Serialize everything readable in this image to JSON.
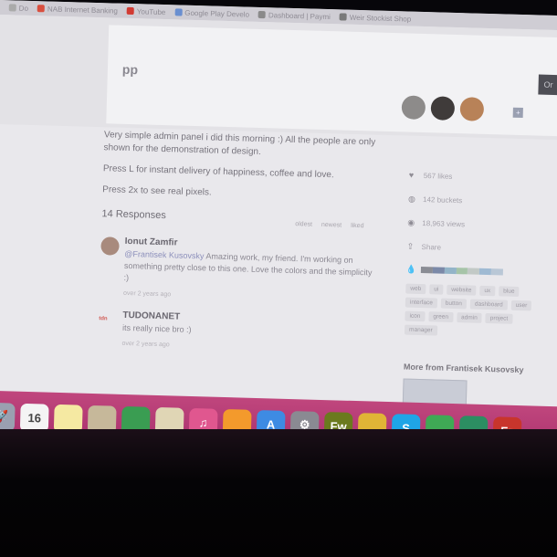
{
  "bookmarks": [
    {
      "label": "Do"
    },
    {
      "label": "NAB Internet Banking",
      "color": "#d94f3f"
    },
    {
      "label": "YouTube",
      "color": "#d23b33"
    },
    {
      "label": "Google Play Develo",
      "color": "#6a8fd0"
    },
    {
      "label": "Dashboard | Paymi",
      "color": "#8a8a8a"
    },
    {
      "label": "Weir Stockist Shop",
      "color": "#7a7a7a"
    }
  ],
  "header": {
    "title": "pp",
    "follow_label": "Or"
  },
  "description": [
    "Very simple admin panel i did this morning :) All the people are only shown for the demonstration of design.",
    "Press L for instant delivery of happiness, coffee and love.",
    "Press 2x to see real pixels."
  ],
  "responses": {
    "count_label": "14 Responses",
    "sort": [
      "oldest",
      "newest",
      "liked"
    ],
    "comments": [
      {
        "author": "Ionut Zamfir",
        "mention": "@Frantisek Kusovsky",
        "text": " Amazing work, my friend. I'm working on something pretty close to this one. Love the colors and the simplicity :)",
        "time": "over 2 years ago"
      },
      {
        "author": "TUDONANET",
        "avatar_text": "tdn",
        "text": "its really nice bro :)",
        "time": "over 2 years ago"
      }
    ]
  },
  "sidebar": {
    "stats": [
      {
        "icon": "heart-icon",
        "glyph": "♥",
        "label": "567 likes"
      },
      {
        "icon": "bucket-icon",
        "glyph": "◍",
        "label": "142 buckets"
      },
      {
        "icon": "eye-icon",
        "glyph": "◉",
        "label": "18,963 views"
      },
      {
        "icon": "share-icon",
        "glyph": "⇪",
        "label": "Share"
      }
    ],
    "palette": [
      "#8a8c94",
      "#7b89a8",
      "#93b4c8",
      "#a6c4a8",
      "#c2c9c6",
      "#9fbad3",
      "#b9c7d6"
    ],
    "tags": [
      "web",
      "ui",
      "website",
      "ux",
      "blue",
      "interface",
      "button",
      "dashboard",
      "user",
      "icon",
      "green",
      "admin",
      "project",
      "manager"
    ],
    "more_from": "More from Frantisek Kusovsky"
  },
  "dock": [
    {
      "name": "launchpad-icon",
      "color": "#9aa0b0",
      "glyph": "🚀"
    },
    {
      "name": "calendar-icon",
      "color": "#f4f4f4",
      "glyph": "16"
    },
    {
      "name": "notes-icon",
      "color": "#f5e9a2",
      "glyph": ""
    },
    {
      "name": "preview-icon",
      "color": "#c6b89a",
      "glyph": ""
    },
    {
      "name": "facetime-icon",
      "color": "#3a9d52",
      "glyph": ""
    },
    {
      "name": "textedit-icon",
      "color": "#e0d6b5",
      "glyph": ""
    },
    {
      "name": "itunes-icon",
      "color": "#e0578f",
      "glyph": "♫"
    },
    {
      "name": "ibooks-icon",
      "color": "#f39a2c",
      "glyph": ""
    },
    {
      "name": "app-store-icon",
      "color": "#3e8be3",
      "glyph": "A"
    },
    {
      "name": "system-preferences-icon",
      "color": "#8a8a92",
      "glyph": "⚙"
    },
    {
      "name": "fireworks-icon",
      "color": "#6b7a1e",
      "glyph": "Fw"
    },
    {
      "name": "chrome-icon",
      "color": "#e0b436",
      "glyph": ""
    },
    {
      "name": "skype-icon",
      "color": "#1fa5e6",
      "glyph": "S"
    },
    {
      "name": "messages-icon",
      "color": "#3fa955",
      "glyph": ""
    },
    {
      "name": "sourcetree-icon",
      "color": "#2c8e62",
      "glyph": ""
    },
    {
      "name": "filezilla-icon",
      "color": "#c8352c",
      "glyph": "Fz"
    }
  ]
}
